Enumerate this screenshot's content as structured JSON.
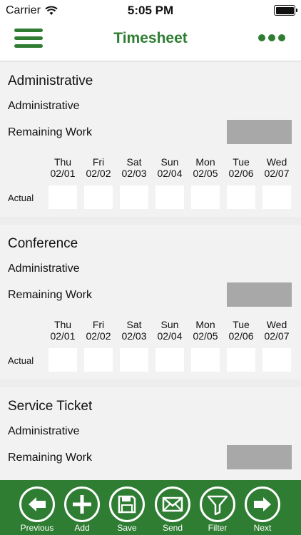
{
  "status_bar": {
    "carrier": "Carrier",
    "time": "5:05 PM",
    "battery_level": 1.0
  },
  "nav": {
    "title": "Timesheet"
  },
  "days": [
    {
      "name": "Thu",
      "date": "02/01"
    },
    {
      "name": "Fri",
      "date": "02/02"
    },
    {
      "name": "Sat",
      "date": "02/03"
    },
    {
      "name": "Sun",
      "date": "02/04"
    },
    {
      "name": "Mon",
      "date": "02/05"
    },
    {
      "name": "Tue",
      "date": "02/06"
    },
    {
      "name": "Wed",
      "date": "02/07"
    }
  ],
  "cards": [
    {
      "name": "Administrative",
      "category": "Administrative",
      "remaining_label": "Remaining Work",
      "actual_label": "Actual",
      "actual_values": [
        "",
        "",
        "",
        "",
        "",
        "",
        ""
      ]
    },
    {
      "name": "Conference",
      "category": "Administrative",
      "remaining_label": "Remaining Work",
      "actual_label": "Actual",
      "actual_values": [
        "",
        "",
        "",
        "",
        "",
        "",
        ""
      ]
    },
    {
      "name": "Service Ticket",
      "category": "Administrative",
      "remaining_label": "Remaining Work"
    }
  ],
  "toolbar": {
    "previous": "Previous",
    "add": "Add",
    "save": "Save",
    "send": "Send",
    "filter": "Filter",
    "next": "Next"
  },
  "colors": {
    "brand_green": "#2e7d32",
    "remaining_box": "#a8a8a8"
  }
}
